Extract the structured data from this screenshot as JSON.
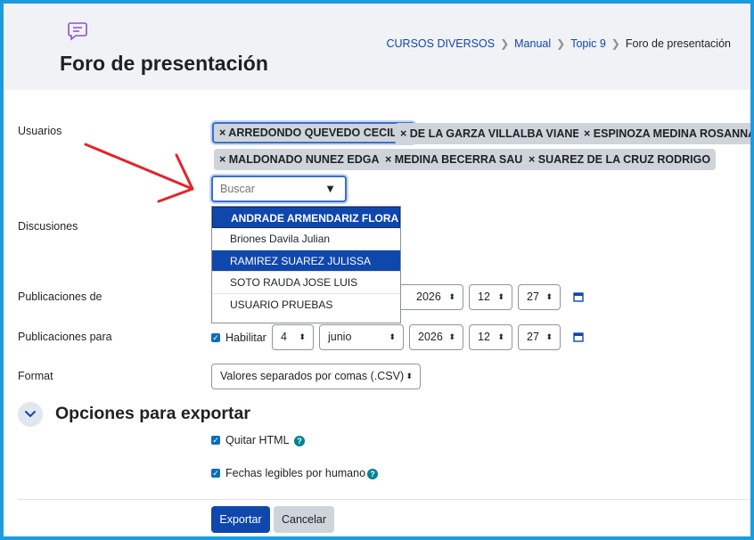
{
  "header": {
    "title": "Foro de presentación",
    "breadcrumb": [
      "CURSOS DIVERSOS",
      "Manual",
      "Topic 9",
      "Foro de presentación"
    ]
  },
  "usuarios": {
    "label": "Usuarios",
    "chips": [
      "× ARREDONDO QUEVEDO CECILIA",
      "× DE LA GARZA VILLALBA VIANEY",
      "× ESPINOZA MEDINA ROSANNA",
      "× MALDONADO NUNEZ EDGAR",
      "× MEDINA BECERRA SAUL",
      "× SUAREZ DE LA CRUZ RODRIGO"
    ],
    "search_placeholder": "Buscar",
    "search_caret": "▼",
    "options": [
      "ANDRADE ARMENDARIZ FLORA",
      "Briones Davila Julian",
      "RAMIREZ SUAREZ JULISSA",
      "SOTO RAUDA JOSE LUIS",
      "USUARIO PRUEBAS"
    ]
  },
  "discusiones": {
    "label": "Discusiones"
  },
  "pub_de": {
    "label": "Publicaciones de",
    "year": "2026",
    "hour": "12",
    "minute": "27"
  },
  "pub_para": {
    "label": "Publicaciones para",
    "enable_label": "Habilitar",
    "day": "4",
    "month": "junio",
    "year": "2026",
    "hour": "12",
    "minute": "27"
  },
  "format": {
    "label": "Format",
    "value": "Valores separados por comas (.CSV)"
  },
  "export_section": {
    "title": "Opciones para exportar",
    "strip_html": "Quitar HTML",
    "human_dates": "Fechas legibles por humano"
  },
  "buttons": {
    "export": "Exportar",
    "cancel": "Cancelar"
  },
  "colors": {
    "primary": "#0f47ad",
    "frame": "#1c9cde",
    "arrow": "#e3242b"
  }
}
